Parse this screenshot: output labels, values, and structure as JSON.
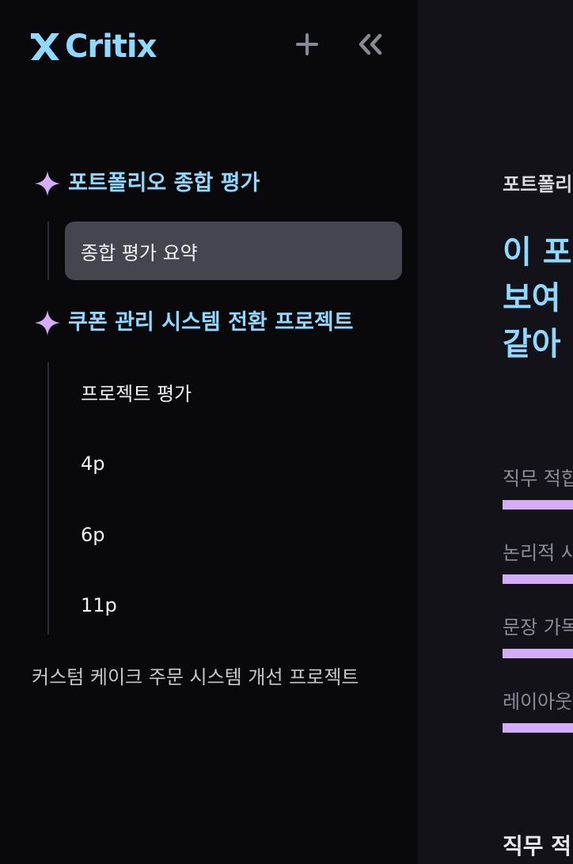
{
  "app": {
    "brand_name": "Critix",
    "accent_color": "#8fd8ff",
    "sparkle_color": "#d5acf7"
  },
  "toolbar": {
    "add_icon": "plus-icon",
    "collapse_icon": "double-chevron-left-icon"
  },
  "sidebar": {
    "sections": [
      {
        "title": "포트폴리오 종합 평가",
        "icon": "sparkle-icon",
        "items": [
          {
            "label": "종합 평가 요약",
            "active": true
          }
        ]
      },
      {
        "title": "쿠폰 관리 시스템 전환 프로젝트",
        "icon": "sparkle-icon",
        "items": [
          {
            "label": "프로젝트 평가",
            "active": false
          },
          {
            "label": "4p",
            "active": false
          },
          {
            "label": "6p",
            "active": false
          },
          {
            "label": "11p",
            "active": false
          }
        ]
      }
    ],
    "collapsed_item": "커스텀 케이크 주문 시스템 개선 프로젝트"
  },
  "main": {
    "breadcrumb": "포트폴리오 종합 평가",
    "heading_lines": [
      "이 포",
      "보여",
      "같아"
    ],
    "metrics": [
      {
        "label": "직무 적합"
      },
      {
        "label": "논리적 사"
      },
      {
        "label": "문장 가독"
      },
      {
        "label": "레이아웃"
      }
    ],
    "section_heading": "직무 적"
  }
}
